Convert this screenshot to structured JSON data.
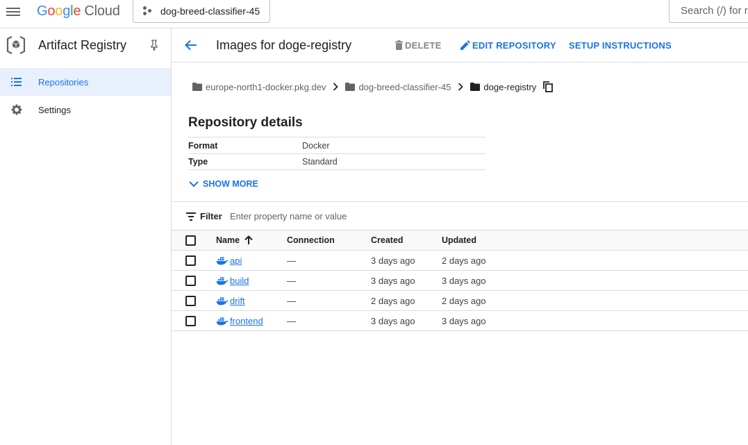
{
  "topbar": {
    "logo_letters": [
      "G",
      "o",
      "o",
      "g",
      "l",
      "e"
    ],
    "logo_suffix": "Cloud",
    "project_name": "dog-breed-classifier-45",
    "search_placeholder": "Search (/) for r"
  },
  "sidebar": {
    "title": "Artifact Registry",
    "items": [
      {
        "label": "Repositories",
        "icon": "list-icon",
        "active": true
      },
      {
        "label": "Settings",
        "icon": "gear-icon",
        "active": false
      }
    ]
  },
  "header": {
    "title": "Images for doge-registry",
    "delete_label": "DELETE",
    "edit_label": "EDIT REPOSITORY",
    "setup_label": "SETUP INSTRUCTIONS"
  },
  "breadcrumb": {
    "items": [
      "europe-north1-docker.pkg.dev",
      "dog-breed-classifier-45",
      "doge-registry"
    ]
  },
  "details": {
    "title": "Repository details",
    "rows": [
      {
        "key": "Format",
        "value": "Docker"
      },
      {
        "key": "Type",
        "value": "Standard"
      }
    ],
    "show_more_label": "SHOW MORE"
  },
  "filter": {
    "label": "Filter",
    "placeholder": "Enter property name or value"
  },
  "table": {
    "columns": [
      "Name",
      "Connection",
      "Created",
      "Updated"
    ],
    "rows": [
      {
        "name": "api",
        "connection": "—",
        "created": "3 days ago",
        "updated": "2 days ago"
      },
      {
        "name": "build",
        "connection": "—",
        "created": "3 days ago",
        "updated": "3 days ago"
      },
      {
        "name": "drift",
        "connection": "—",
        "created": "2 days ago",
        "updated": "2 days ago"
      },
      {
        "name": "frontend",
        "connection": "—",
        "created": "3 days ago",
        "updated": "3 days ago"
      }
    ]
  },
  "colors": {
    "accent": "#1a73e8",
    "active_bg": "#e8f0fe",
    "border": "#dadce0"
  }
}
